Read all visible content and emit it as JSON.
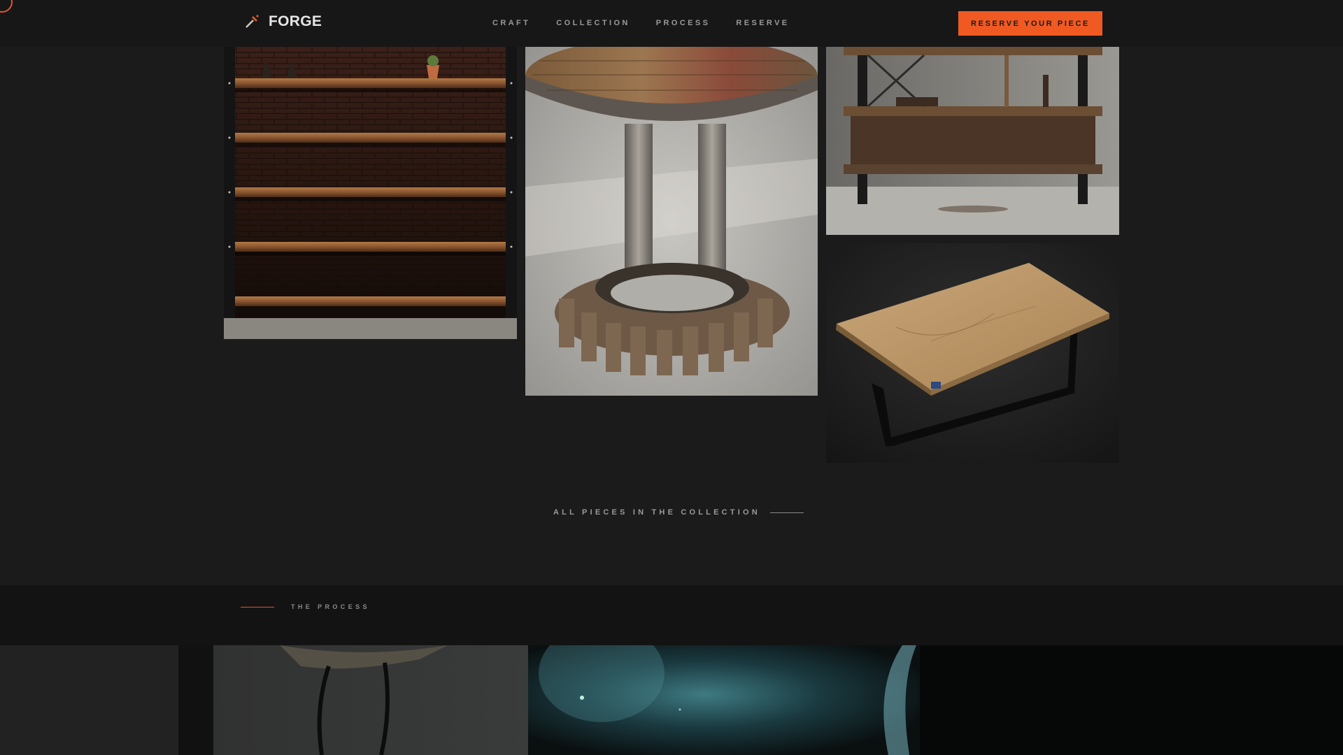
{
  "header": {
    "brand": "FORGE",
    "nav": [
      "CRAFT",
      "COLLECTION",
      "PROCESS",
      "RESERVE"
    ],
    "cta": "RESERVE YOUR PIECE"
  },
  "gallery": {
    "items": [
      {
        "name": "wood-steel-shelving"
      },
      {
        "name": "gear-base-side-table"
      },
      {
        "name": "industrial-bookcase"
      },
      {
        "name": "oak-coffee-table"
      }
    ]
  },
  "collection_link": "ALL PIECES IN THE COLLECTION",
  "process": {
    "label": "THE PROCESS"
  },
  "colors": {
    "accent": "#f05a22",
    "background": "#1b1b1b",
    "header": "#171717"
  }
}
